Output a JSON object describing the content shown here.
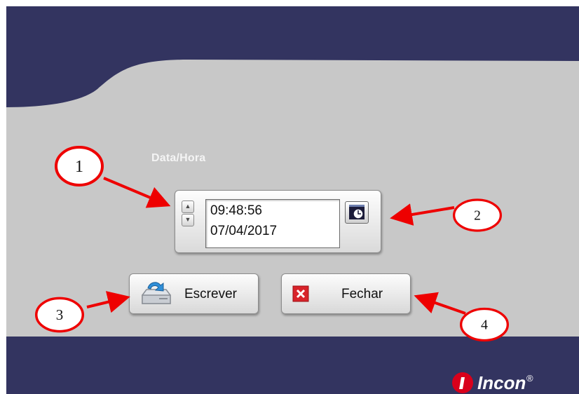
{
  "datetime": {
    "label": "Data/Hora",
    "time": "09:48:56",
    "date": "07/04/2017"
  },
  "buttons": {
    "write_label": "Escrever",
    "close_label": "Fechar"
  },
  "brand": {
    "logo_text": "Incon",
    "registered_mark": "®"
  },
  "callouts": [
    "1",
    "2",
    "3",
    "4"
  ],
  "colors": {
    "header_navy": "#333460",
    "panel_gray": "#c8c8c8",
    "callout_red": "#ee0000",
    "close_icon_red": "#d8232a",
    "logo_red": "#d9001b"
  },
  "icons": [
    "spin-up-icon",
    "spin-down-icon",
    "clock-calendar-icon",
    "save-drive-icon",
    "close-x-icon",
    "incon-logo"
  ]
}
